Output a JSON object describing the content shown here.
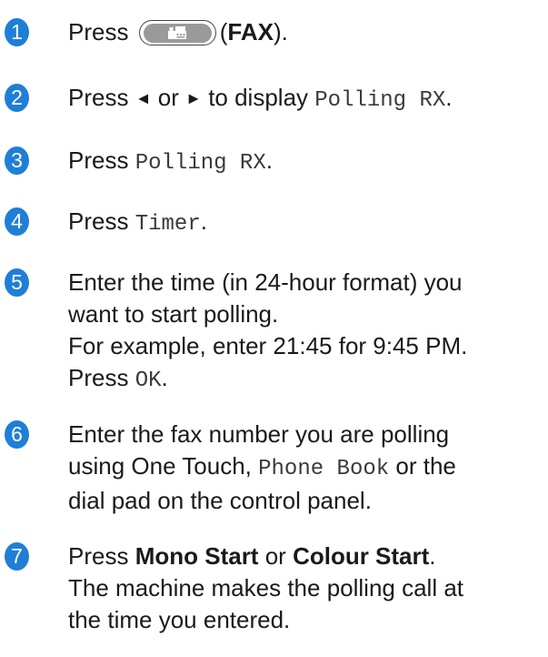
{
  "steps": [
    {
      "number": "1",
      "press": "Press",
      "paren_open": "(",
      "fax_label": "FAX",
      "paren_close": ")."
    },
    {
      "number": "2",
      "press": "Press",
      "or": "or",
      "to_display": "to display",
      "value": "Polling RX",
      "end": "."
    },
    {
      "number": "3",
      "press": "Press",
      "value": "Polling RX",
      "end": "."
    },
    {
      "number": "4",
      "press": "Press",
      "value": "Timer",
      "end": "."
    },
    {
      "number": "5",
      "line1": "Enter the time (in 24-hour format) you",
      "line2": "want to start polling.",
      "line3": "For example, enter 21:45 for 9:45 PM.",
      "press": "Press",
      "ok": "OK",
      "end": "."
    },
    {
      "number": "6",
      "line1": "Enter the fax number you are polling",
      "line2_pre": "using One Touch,",
      "phone_book": "Phone Book",
      "line2_post": "or the",
      "line3": "dial pad on the control panel."
    },
    {
      "number": "7",
      "press": "Press",
      "mono_start": "Mono Start",
      "or": "or",
      "colour_start": "Colour Start",
      "end": ".",
      "line2": "The machine makes the polling call at",
      "line3": "the time you entered."
    }
  ],
  "icons": {
    "left_arrow": "◄",
    "right_arrow": "►",
    "fax_button": "fax-machine-icon"
  },
  "colors": {
    "step_number_bg": "#1f7fd6",
    "fax_button_fill": "#9a9a9a"
  }
}
